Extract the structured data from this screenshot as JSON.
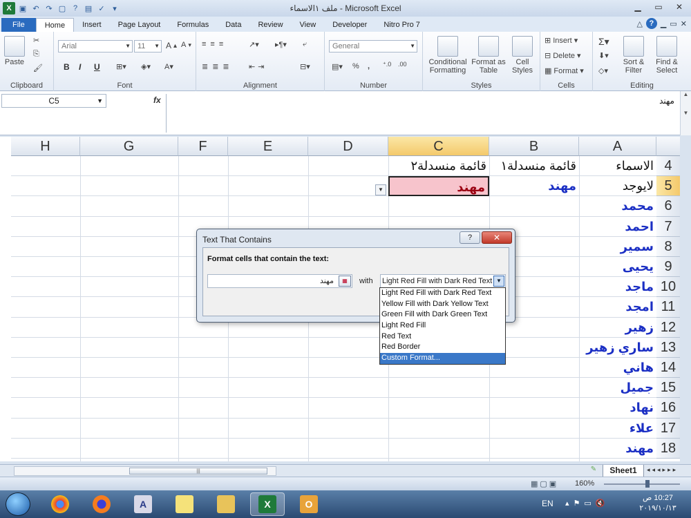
{
  "window": {
    "title": "ملف ١الاسماء - Microsoft Excel",
    "controls": [
      "▁",
      "▭",
      "✕"
    ]
  },
  "tabs": [
    "File",
    "Home",
    "Insert",
    "Page Layout",
    "Formulas",
    "Data",
    "Review",
    "View",
    "Developer",
    "Nitro Pro 7"
  ],
  "ribbon": {
    "clipboard": {
      "label": "Clipboard",
      "paste": "Paste"
    },
    "font": {
      "label": "Font",
      "name": "Arial",
      "size": "11",
      "bold": "B",
      "italic": "I",
      "underline": "U"
    },
    "alignment": {
      "label": "Alignment"
    },
    "number": {
      "label": "Number",
      "format": "General",
      "percent": "%",
      "comma": ","
    },
    "styles": {
      "label": "Styles",
      "conditional": "Conditional Formatting",
      "format_table": "Format as Table",
      "cell_styles": "Cell Styles"
    },
    "cells": {
      "label": "Cells",
      "insert": "Insert",
      "delete": "Delete",
      "format": "Format"
    },
    "editing": {
      "label": "Editing",
      "sort": "Sort & Filter",
      "find": "Find & Select"
    }
  },
  "formula_bar": {
    "name_box": "C5",
    "fx": "fx",
    "content": "مهند"
  },
  "columns": [
    {
      "id": "H",
      "selected": false
    },
    {
      "id": "G",
      "selected": false
    },
    {
      "id": "F",
      "selected": false
    },
    {
      "id": "E",
      "selected": false
    },
    {
      "id": "D",
      "selected": false
    },
    {
      "id": "C",
      "selected": true
    },
    {
      "id": "B",
      "selected": false
    },
    {
      "id": "A",
      "selected": false
    }
  ],
  "rows": [
    {
      "n": "4",
      "a": "الاسماء",
      "b": "قائمة منسدلة١",
      "c": "قائمة منسدلة٢"
    },
    {
      "n": "5",
      "a": "لايوجد",
      "b": "مهند",
      "c": "مهند"
    },
    {
      "n": "6",
      "a": "محمد",
      "b": "",
      "c": ""
    },
    {
      "n": "7",
      "a": "احمد",
      "b": "",
      "c": ""
    },
    {
      "n": "8",
      "a": "سمير",
      "b": "",
      "c": ""
    },
    {
      "n": "9",
      "a": "يحيى",
      "b": "",
      "c": ""
    },
    {
      "n": "10",
      "a": "ماجد",
      "b": "",
      "c": ""
    },
    {
      "n": "11",
      "a": "امجد",
      "b": "",
      "c": ""
    },
    {
      "n": "12",
      "a": "زهير",
      "b": "",
      "c": ""
    },
    {
      "n": "13",
      "a": "ساري زهير",
      "b": "",
      "c": ""
    },
    {
      "n": "14",
      "a": "هاني",
      "b": "",
      "c": ""
    },
    {
      "n": "15",
      "a": "جميل",
      "b": "",
      "c": ""
    },
    {
      "n": "16",
      "a": "نهاد",
      "b": "",
      "c": ""
    },
    {
      "n": "17",
      "a": "علاء",
      "b": "",
      "c": ""
    },
    {
      "n": "18",
      "a": "مهند",
      "b": "",
      "c": ""
    }
  ],
  "dialog": {
    "title": "Text That Contains",
    "help": "?",
    "close": "✕",
    "prompt": "Format cells that contain the text:",
    "input_value": "مهند",
    "with_label": "with",
    "selected": "Light Red Fill with Dark Red Text",
    "options": [
      "Light Red Fill with Dark Red Text",
      "Yellow Fill with Dark Yellow Text",
      "Green Fill with Dark Green Text",
      "Light Red Fill",
      "Red Text",
      "Red Border",
      "Custom Format..."
    ],
    "highlighted_index": 6
  },
  "sheet": {
    "tab": "Sheet1"
  },
  "status": {
    "zoom": "160%"
  },
  "taskbar": {
    "lang": "EN",
    "time": "10:27 ص",
    "date": "٢٠١٩/١٠/١٣"
  }
}
